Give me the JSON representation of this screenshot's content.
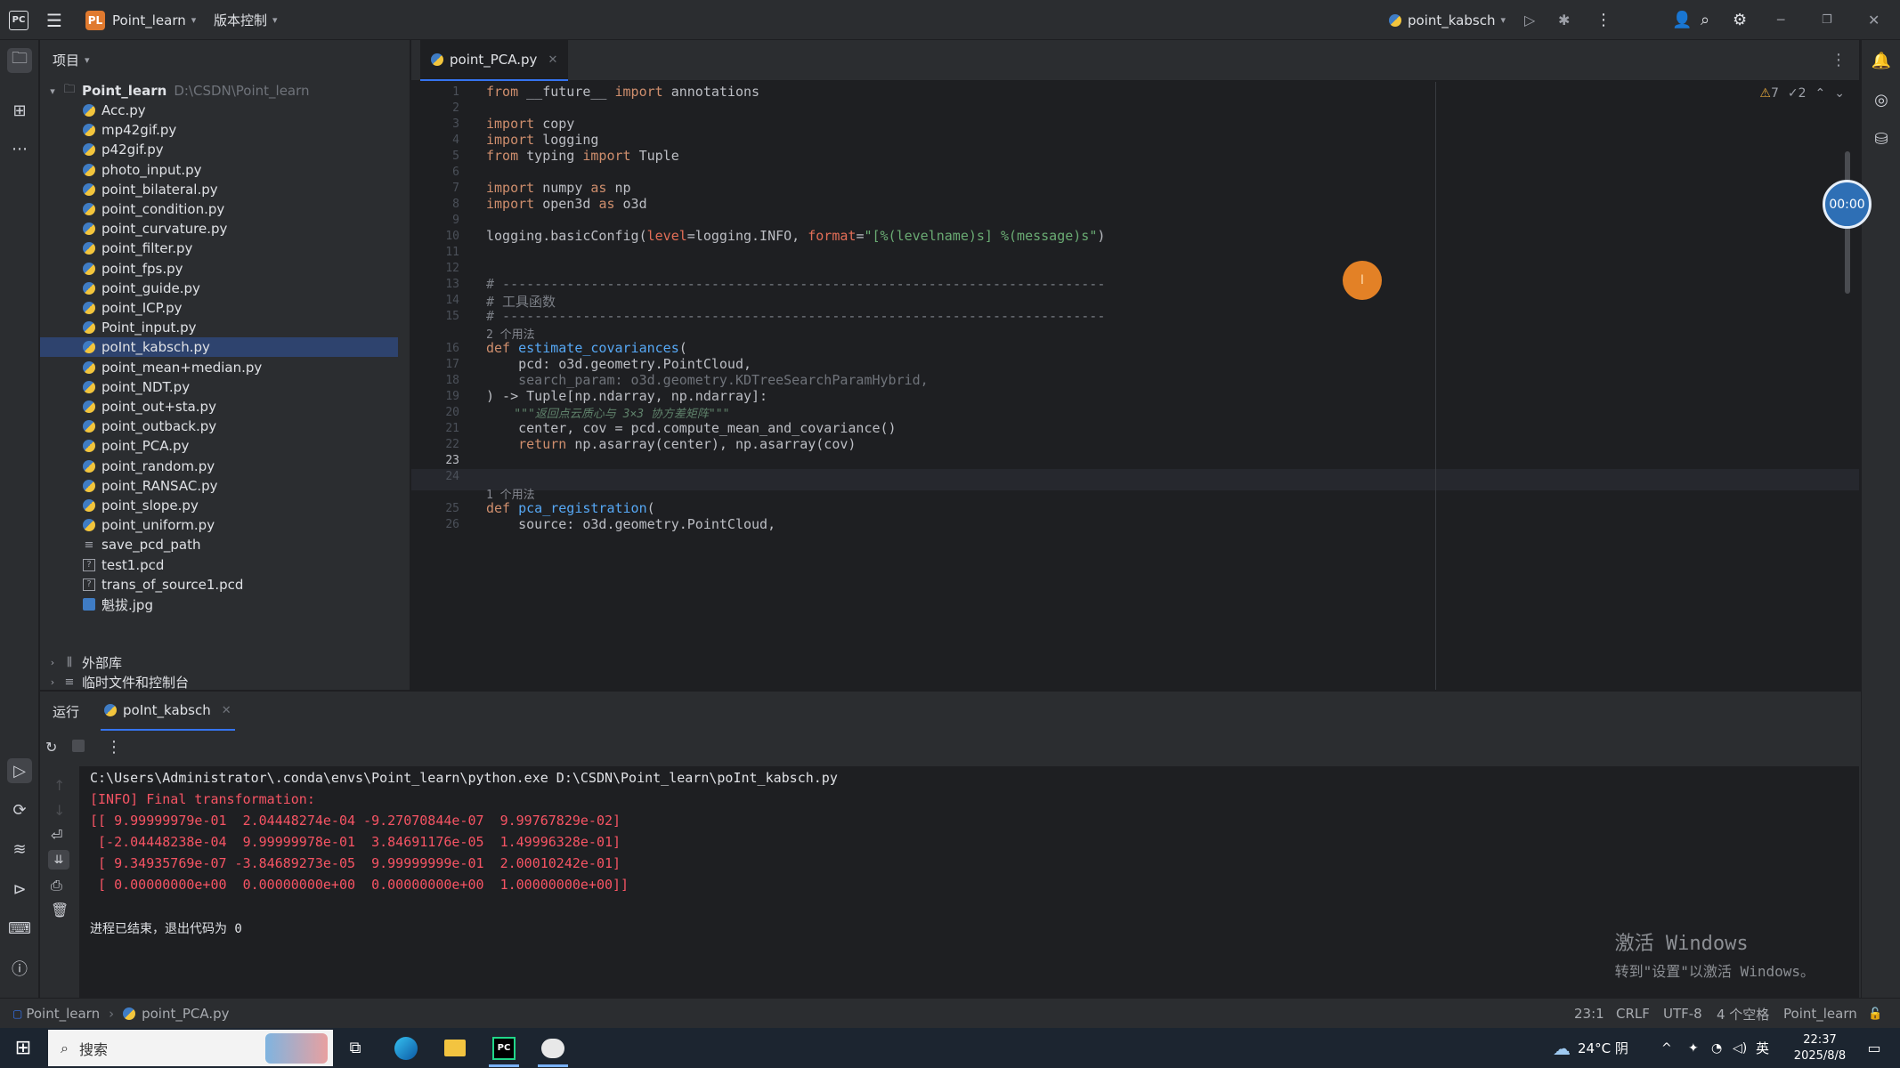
{
  "titlebar": {
    "app_badge": "PL",
    "project_name": "Point_learn",
    "vcs_label": "版本控制",
    "run_config": "point_kabsch"
  },
  "project_panel": {
    "header": "项目",
    "root_name": "Point_learn",
    "root_path": "D:\\CSDN\\Point_learn",
    "files": [
      {
        "name": "Acc.py",
        "type": "py"
      },
      {
        "name": "mp42gif.py",
        "type": "py"
      },
      {
        "name": "p42gif.py",
        "type": "py"
      },
      {
        "name": "photo_input.py",
        "type": "py"
      },
      {
        "name": "point_bilateral.py",
        "type": "py"
      },
      {
        "name": "point_condition.py",
        "type": "py"
      },
      {
        "name": "point_curvature.py",
        "type": "py"
      },
      {
        "name": "point_filter.py",
        "type": "py"
      },
      {
        "name": "point_fps.py",
        "type": "py"
      },
      {
        "name": "point_guide.py",
        "type": "py"
      },
      {
        "name": "point_ICP.py",
        "type": "py"
      },
      {
        "name": "Point_input.py",
        "type": "py"
      },
      {
        "name": "poInt_kabsch.py",
        "type": "py",
        "selected": true
      },
      {
        "name": "point_mean+median.py",
        "type": "py"
      },
      {
        "name": "point_NDT.py",
        "type": "py"
      },
      {
        "name": "point_out+sta.py",
        "type": "py"
      },
      {
        "name": "point_outback.py",
        "type": "py"
      },
      {
        "name": "point_PCA.py",
        "type": "py"
      },
      {
        "name": "point_random.py",
        "type": "py"
      },
      {
        "name": "point_RANSAC.py",
        "type": "py"
      },
      {
        "name": "point_slope.py",
        "type": "py"
      },
      {
        "name": "point_uniform.py",
        "type": "py"
      },
      {
        "name": "save_pcd_path",
        "type": "txt"
      },
      {
        "name": "test1.pcd",
        "type": "pcd"
      },
      {
        "name": "trans_of_source1.pcd",
        "type": "pcd"
      },
      {
        "name": "魁拔.jpg",
        "type": "img"
      }
    ],
    "external_libs": "外部库",
    "scratches": "临时文件和控制台"
  },
  "editor": {
    "tab_label": "point_PCA.py",
    "inspection_warnings": "7",
    "inspection_ok": "2",
    "usage_hint_1": "2 个用法",
    "usage_hint_2": "1 个用法",
    "line_numbers": [
      "1",
      "2",
      "3",
      "4",
      "5",
      "6",
      "7",
      "8",
      "9",
      "10",
      "11",
      "12",
      "13",
      "14",
      "15",
      "16",
      "17",
      "18",
      "19",
      "20",
      "21",
      "22",
      "23",
      "24",
      "25",
      "26"
    ],
    "code": {
      "l1": [
        "from",
        " __future__ ",
        "import",
        " annotations"
      ],
      "l3": [
        "import",
        " copy"
      ],
      "l4": [
        "import",
        " logging"
      ],
      "l5": [
        "from",
        " typing ",
        "import",
        " Tuple"
      ],
      "l7": [
        "import",
        " numpy ",
        "as",
        " np"
      ],
      "l8": [
        "import",
        " open3d ",
        "as",
        " o3d"
      ],
      "l10": [
        "logging.basicConfig(",
        "level",
        "=logging.INFO, ",
        "format",
        "=",
        "\"[%(levelname)s] %(message)s\"",
        ")"
      ],
      "l13": "# ---------------------------------------------------------------------------",
      "l14": "# 工具函数",
      "l15": "# ---------------------------------------------------------------------------",
      "l16": [
        "def",
        " ",
        "estimate_covariances",
        "("
      ],
      "l17": "    pcd: o3d.geometry.PointCloud,",
      "l18": "    search_param: o3d.geometry.KDTreeSearchParamHybrid,",
      "l19": ") -> Tuple[np.ndarray, np.ndarray]:",
      "l20": "    \"\"\"返回点云质心与 3×3 协方差矩阵\"\"\"",
      "l21": "    center, cov = pcd.compute_mean_and_covariance()",
      "l22": [
        "    ",
        "return",
        " np.asarray(center), np.asarray(cov)"
      ],
      "l25": [
        "def",
        " ",
        "pca_registration",
        "("
      ],
      "l26": "    source: o3d.geometry.PointCloud,"
    },
    "timer_label": "00:00"
  },
  "run_panel": {
    "title": "运行",
    "tab_label": "poInt_kabsch",
    "console": {
      "cmd": "C:\\Users\\Administrator\\.conda\\envs\\Point_learn\\python.exe D:\\CSDN\\Point_learn\\poInt_kabsch.py",
      "info": "[INFO] Final transformation:",
      "row1": "[[ 9.99999979e-01  2.04448274e-04 -9.27070844e-07  9.99767829e-02]",
      "row2": " [-2.04448238e-04  9.99999978e-01  3.84691176e-05  1.49996328e-01]",
      "row3": " [ 9.34935769e-07 -3.84689273e-05  9.99999999e-01  2.00010242e-01]",
      "row4": " [ 0.00000000e+00  0.00000000e+00  0.00000000e+00  1.00000000e+00]]",
      "exit": "进程已结束，退出代码为 0"
    },
    "activate_title": "激活 Windows",
    "activate_sub": "转到\"设置\"以激活 Windows。"
  },
  "statusbar": {
    "crumb_project": "Point_learn",
    "crumb_file": "point_PCA.py",
    "position": "23:1",
    "line_sep": "CRLF",
    "encoding": "UTF-8",
    "indent": "4 个空格",
    "interpreter": "Point_learn"
  },
  "taskbar": {
    "search_placeholder": "搜索",
    "weather": "24°C 阴",
    "ime": "英",
    "time": "22:37",
    "date": "2025/8/8"
  }
}
